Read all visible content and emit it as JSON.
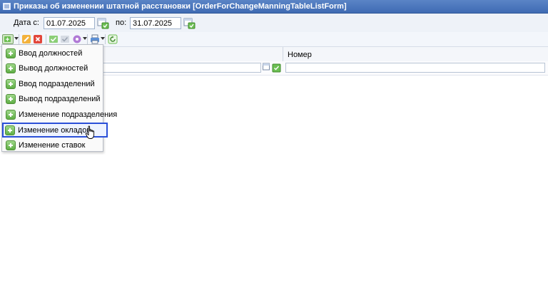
{
  "window": {
    "title": "Приказы об изменении штатной расстановки [OrderForChangeManningTableListForm]"
  },
  "filter": {
    "date_from_label": "Дата с:",
    "date_from": "01.07.2025",
    "date_to_label": "по:",
    "date_to": "31.07.2025"
  },
  "grid": {
    "columns": [
      "",
      "Номер"
    ]
  },
  "menu": {
    "items": [
      {
        "label": "Ввод должностей"
      },
      {
        "label": "Вывод должностей"
      },
      {
        "label": "Ввод подразделений"
      },
      {
        "label": "Вывод подразделений"
      },
      {
        "label": "Изменение подразделения"
      },
      {
        "label": "Изменение окладов",
        "highlighted": true
      },
      {
        "label": "Изменение ставок"
      }
    ]
  },
  "colors": {
    "title_bar": "#4a75bd",
    "highlight_border": "#2a4fd8",
    "menu_icon": "#5fae45"
  }
}
